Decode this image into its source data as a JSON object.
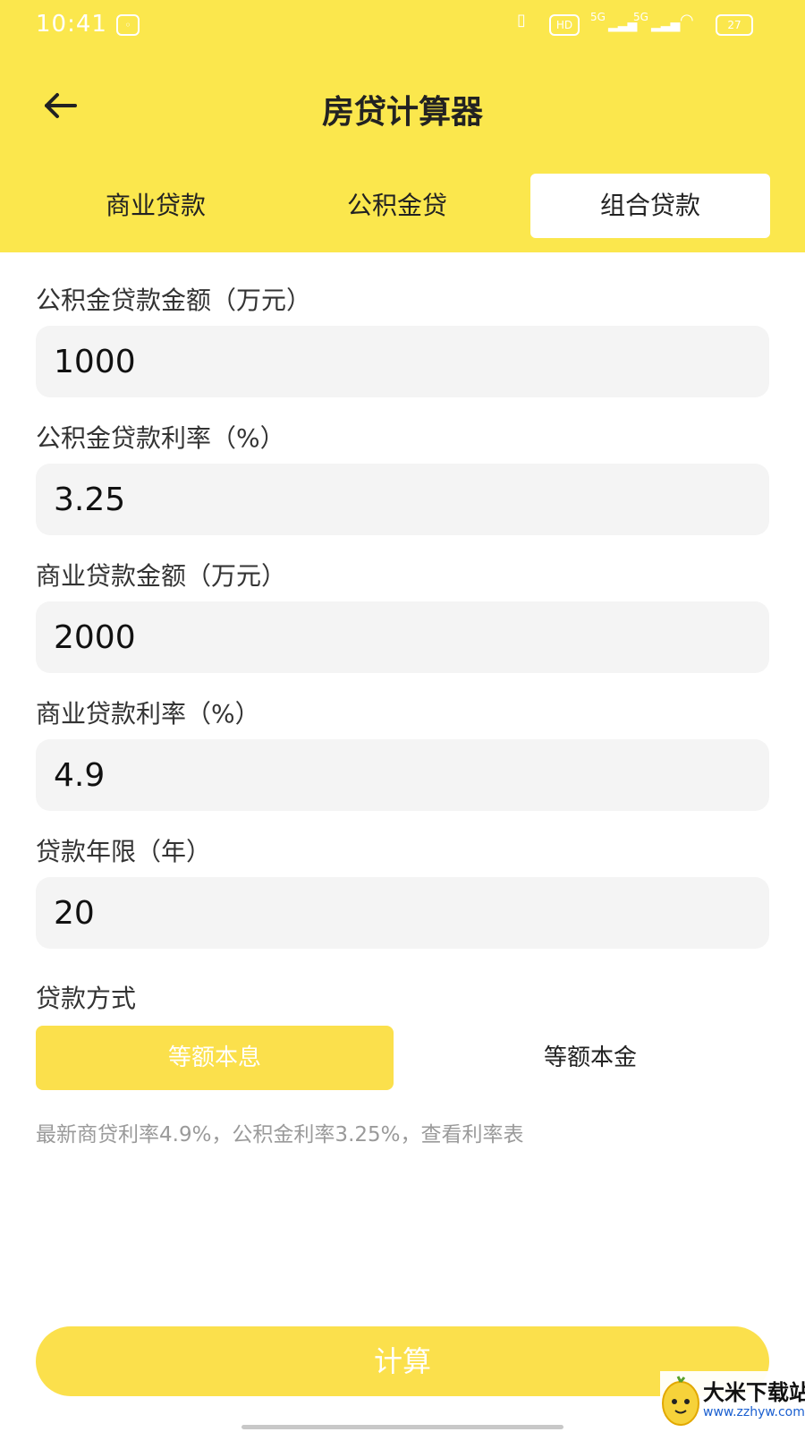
{
  "status_bar": {
    "time": "10:41",
    "battery": "27",
    "hd": "HD",
    "signal_1": "5G",
    "signal_2": "5G"
  },
  "header": {
    "title": "房贷计算器",
    "back_icon": "arrow-left-icon"
  },
  "tabs": [
    {
      "label": "商业贷款",
      "active": false
    },
    {
      "label": "公积金贷",
      "active": false
    },
    {
      "label": "组合贷款",
      "active": true
    }
  ],
  "fields": [
    {
      "label": "公积金贷款金额（万元）",
      "value": "1000"
    },
    {
      "label": "公积金贷款利率（%）",
      "value": "3.25"
    },
    {
      "label": "商业贷款金额（万元）",
      "value": "2000"
    },
    {
      "label": "商业贷款利率（%）",
      "value": "4.9"
    },
    {
      "label": "贷款年限（年）",
      "value": "20"
    }
  ],
  "repayment": {
    "label": "贷款方式",
    "options": [
      {
        "label": "等额本息",
        "selected": true
      },
      {
        "label": "等额本金",
        "selected": false
      }
    ]
  },
  "rate_note": "最新商贷利率4.9%，公积金利率3.25%，查看利率表",
  "calculate_label": "计算",
  "watermark": {
    "name": "大米下载站",
    "url": "www.zzhyw.com"
  },
  "colors": {
    "accent": "#fbe74d",
    "button": "#fbe04c",
    "field_bg": "#f4f4f4",
    "note": "#9a9a9a"
  }
}
